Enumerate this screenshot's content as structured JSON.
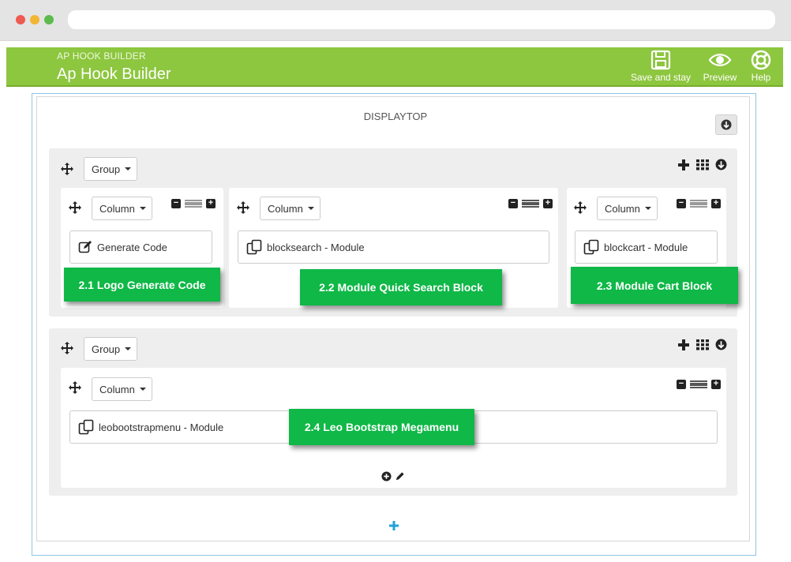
{
  "header": {
    "subtitle": "AP HOOK BUILDER",
    "title": "Ap Hook Builder",
    "save_label": "Save and stay",
    "preview_label": "Preview",
    "help_label": "Help"
  },
  "hook": {
    "name": "DISPLAYTOP"
  },
  "group1": {
    "group_label": "Group",
    "columns": [
      {
        "column_label": "Column",
        "widget_label": "Generate Code",
        "callout": "2.1 Logo Generate Code"
      },
      {
        "column_label": "Column",
        "widget_label": "blocksearch - Module",
        "callout": "2.2 Module Quick Search Block"
      },
      {
        "column_label": "Column",
        "widget_label": "blockcart - Module",
        "callout": "2.3 Module Cart Block"
      }
    ]
  },
  "group2": {
    "group_label": "Group",
    "columns": [
      {
        "column_label": "Column",
        "widget_label": "leobootstrapmenu - Module",
        "callout": "2.4 Leo Bootstrap Megamenu"
      }
    ]
  },
  "colors": {
    "header_green": "#8dc63f",
    "callout_green": "#0fb847",
    "add_group_blue": "#1fa3d8"
  }
}
